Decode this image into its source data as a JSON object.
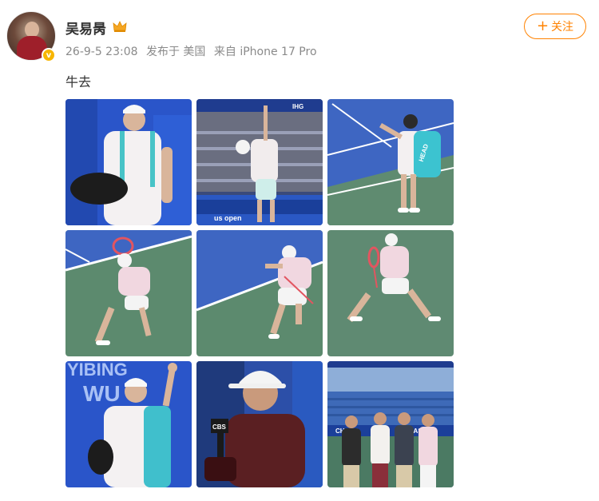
{
  "user": {
    "name": "吴易昺",
    "verified_badge": "v"
  },
  "meta": {
    "date": "26-9-5 23:08",
    "posted_from_label": "发布于 美国",
    "device_label": "来自 iPhone 17 Pro"
  },
  "follow": {
    "plus": "+",
    "label": "关注"
  },
  "post": {
    "text": "牛去"
  },
  "photo_text": {
    "p2_board": "IHG",
    "p2_usopen": "us open",
    "p3_bag": "HEAD",
    "p7_banner_1": "YIBING",
    "p7_banner_2": "WU",
    "p8_mic": "CBS",
    "p9_sponsor": "CHASE"
  },
  "colors": {
    "accent": "#ff8200",
    "court_blue": "#3a63c4",
    "court_green": "#5c8a6e",
    "verified": "#f7b500"
  }
}
